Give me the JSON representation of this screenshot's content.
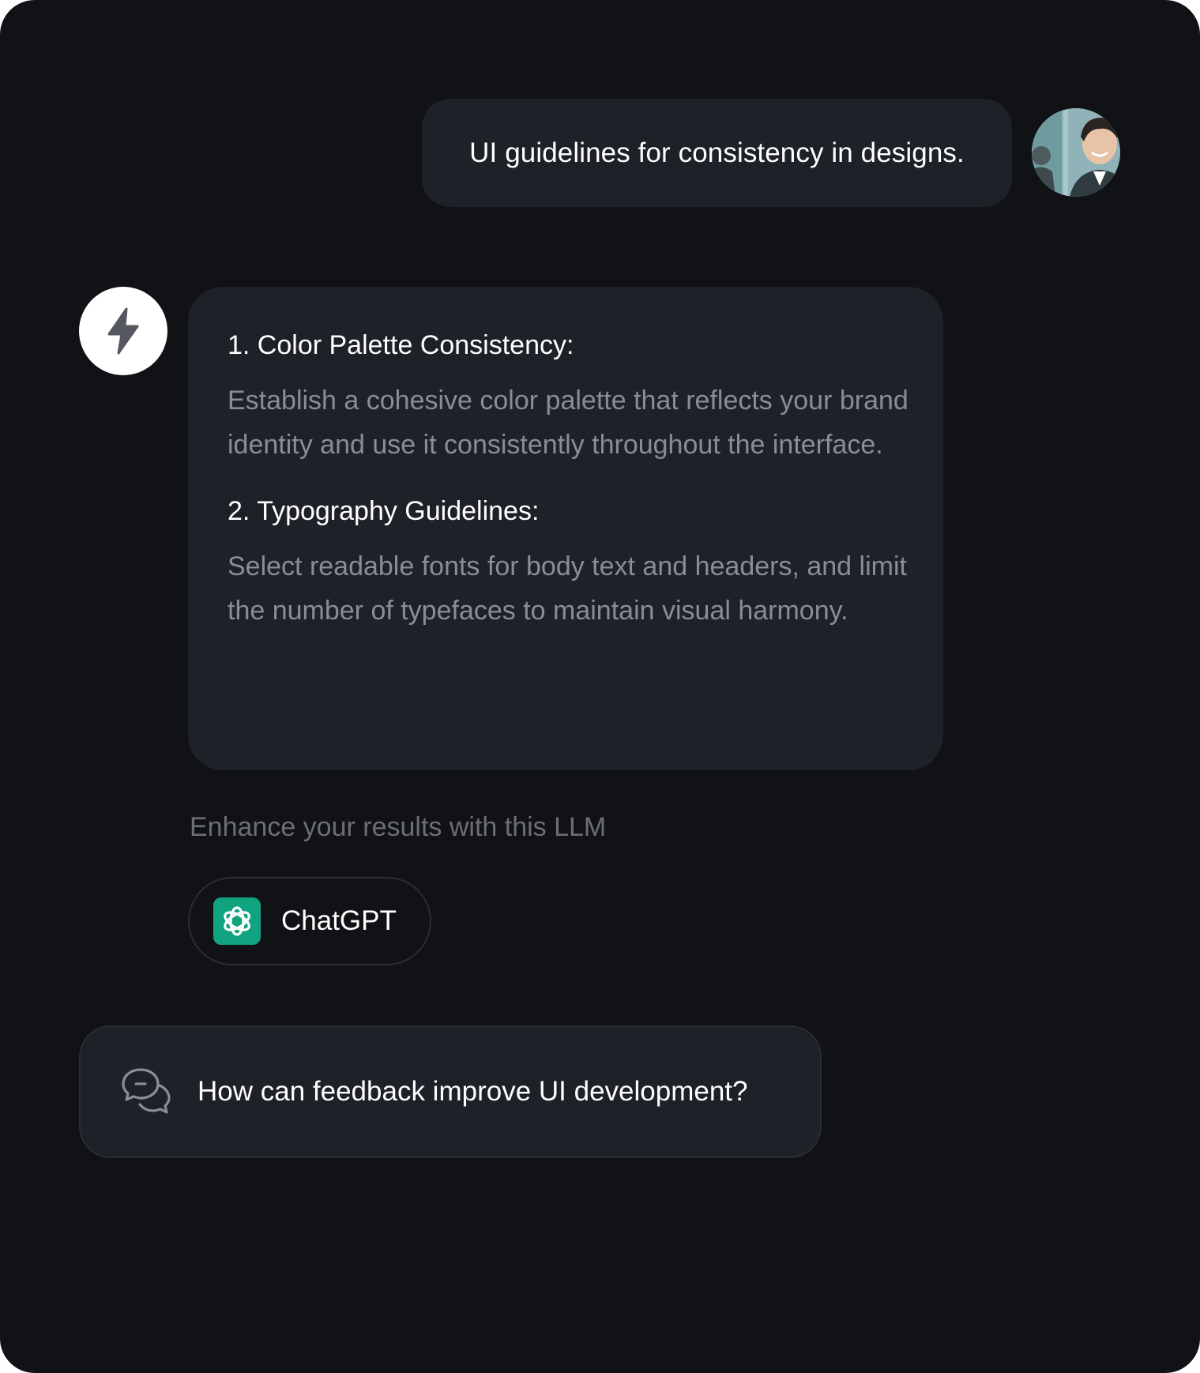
{
  "user_message": {
    "text": "UI guidelines for consistency in designs.",
    "avatar_icon": "user-avatar-photo"
  },
  "assistant_message": {
    "icon": "lightning-bolt-icon",
    "sections": [
      {
        "title": "1. Color Palette Consistency:",
        "body": "Establish a cohesive color palette that reflects your brand identity and use it consistently throughout the interface."
      },
      {
        "title": "2. Typography Guidelines:",
        "body": "Select readable fonts for body text and headers, and limit the number of typefaces to maintain visual harmony."
      }
    ]
  },
  "enhance": {
    "label": "Enhance your results with this LLM",
    "llm_name": "ChatGPT",
    "llm_icon": "openai-logo-icon",
    "llm_color": "#10a37f"
  },
  "suggestion": {
    "icon": "chat-bubbles-icon",
    "text": "How can feedback improve UI development?"
  },
  "colors": {
    "background": "#111215",
    "bubble": "#1e2128",
    "muted_text": "#8a8d93"
  }
}
